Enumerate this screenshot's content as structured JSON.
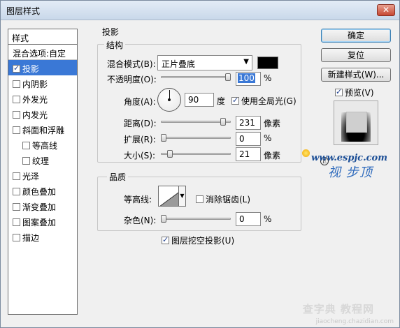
{
  "window": {
    "title": "图层样式",
    "close_glyph": "✕"
  },
  "style_list": {
    "header": "样式",
    "items": [
      {
        "label": "混合选项:自定",
        "checkbox": false,
        "checked": false,
        "sub": false,
        "selected": false
      },
      {
        "label": "投影",
        "checkbox": true,
        "checked": true,
        "sub": false,
        "selected": true
      },
      {
        "label": "内阴影",
        "checkbox": true,
        "checked": false,
        "sub": false,
        "selected": false
      },
      {
        "label": "外发光",
        "checkbox": true,
        "checked": false,
        "sub": false,
        "selected": false
      },
      {
        "label": "内发光",
        "checkbox": true,
        "checked": false,
        "sub": false,
        "selected": false
      },
      {
        "label": "斜面和浮雕",
        "checkbox": true,
        "checked": false,
        "sub": false,
        "selected": false
      },
      {
        "label": "等高线",
        "checkbox": true,
        "checked": false,
        "sub": true,
        "selected": false
      },
      {
        "label": "纹理",
        "checkbox": true,
        "checked": false,
        "sub": true,
        "selected": false
      },
      {
        "label": "光泽",
        "checkbox": true,
        "checked": false,
        "sub": false,
        "selected": false
      },
      {
        "label": "颜色叠加",
        "checkbox": true,
        "checked": false,
        "sub": false,
        "selected": false
      },
      {
        "label": "渐变叠加",
        "checkbox": true,
        "checked": false,
        "sub": false,
        "selected": false
      },
      {
        "label": "图案叠加",
        "checkbox": true,
        "checked": false,
        "sub": false,
        "selected": false
      },
      {
        "label": "描边",
        "checkbox": true,
        "checked": false,
        "sub": false,
        "selected": false
      }
    ]
  },
  "drop_shadow": {
    "title": "投影",
    "structure": {
      "title": "结构",
      "blend_mode_label": "混合模式(B):",
      "blend_mode_value": "正片叠底",
      "blend_color": "#000000",
      "opacity_label": "不透明度(O):",
      "opacity_value": "100",
      "opacity_fraction": 1.0,
      "percent": "%",
      "angle_label": "角度(A):",
      "angle_value": "90",
      "angle_unit": "度",
      "global_light_label": "使用全局光(G)",
      "global_light_checked": true,
      "distance_label": "距离(D):",
      "distance_value": "231",
      "distance_fraction": 0.92,
      "px_unit": "像素",
      "spread_label": "扩展(R):",
      "spread_value": "0",
      "spread_fraction": 0.0,
      "size_label": "大小(S):",
      "size_value": "21",
      "size_fraction": 0.1
    },
    "quality": {
      "title": "品质",
      "contour_label": "等高线:",
      "antialias_label": "消除锯齿(L)",
      "antialias_checked": false,
      "noise_label": "杂色(N):",
      "noise_value": "0",
      "noise_fraction": 0.0
    },
    "knockout_label": "图层挖空投影(U)",
    "knockout_checked": true
  },
  "buttons": {
    "ok": "确定",
    "reset": "复位",
    "new_style": "新建样式(W)...",
    "preview_label": "预览(V)",
    "preview_checked": true
  },
  "watermarks": {
    "url": "www.espjc.com",
    "brand": "视 步顶",
    "e_mark": "E",
    "site": "查字典 教程网",
    "site_sub": "jiaocheng.chazidian.com"
  }
}
